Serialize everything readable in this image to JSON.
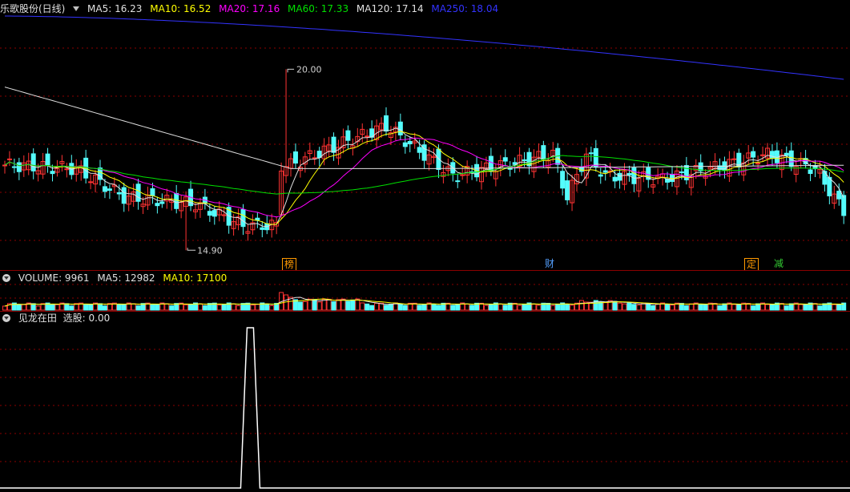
{
  "main_header": {
    "title": "乐歌股份(日线)",
    "ma5": "MA5: 16.23",
    "ma10": "MA10: 16.52",
    "ma20": "MA20: 17.16",
    "ma60": "MA60: 17.33",
    "ma120": "MA120: 17.14",
    "ma250": "MA250: 18.04"
  },
  "volume_header": {
    "title": "VOLUME: 9961",
    "ma5": "MA5: 12982",
    "ma10": "MA10: 17100"
  },
  "indicator_header": {
    "title": "见龙在田",
    "value": "选股: 0.00"
  },
  "annotations": {
    "high_label": "20.00",
    "low_label": "14.90"
  },
  "event_tags": [
    "榜",
    "财",
    "定",
    "减"
  ],
  "colors": {
    "up": "#ff3333",
    "down": "#54fcfc",
    "ma5": "#e0e0e0",
    "ma10": "#ffff00",
    "ma20": "#ff00ff",
    "ma60": "#00e000",
    "ma120": "#e0e0e0",
    "ma250": "#3333ff",
    "grid": "#8b0000"
  },
  "chart_data": [
    {
      "type": "candlestick",
      "title": "乐歌股份(日线)",
      "ylim": [
        14.5,
        21.5
      ],
      "annotated_high": 20.0,
      "annotated_low": 14.9,
      "moving_averages": {
        "MA5": 16.23,
        "MA10": 16.52,
        "MA20": 17.16,
        "MA60": 17.33,
        "MA120": 17.14,
        "MA250": 18.04
      },
      "grid": true
    },
    {
      "type": "bar",
      "title": "VOLUME",
      "last_value": 9961,
      "moving_averages": {
        "MA5": 12982,
        "MA10": 17100
      }
    },
    {
      "type": "line",
      "title": "见龙在田",
      "last_value": 0.0,
      "pulse_value": 1
    }
  ]
}
